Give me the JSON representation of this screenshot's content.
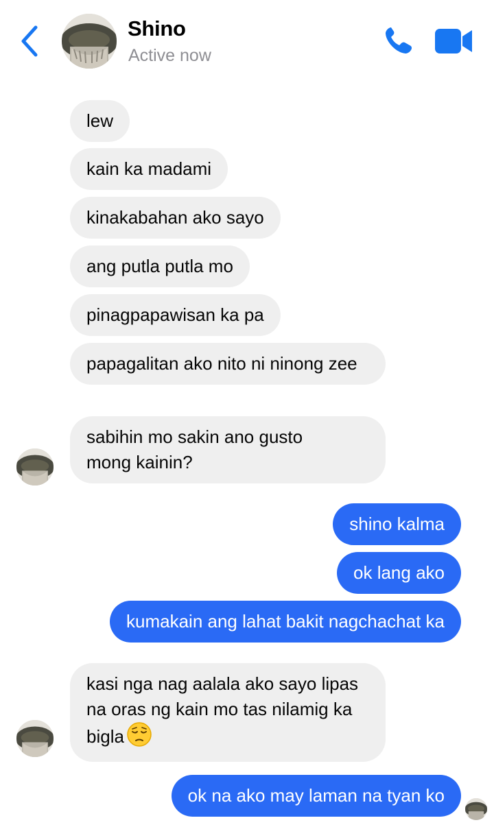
{
  "header": {
    "contact_name": "Shino",
    "status": "Active now",
    "back_icon": "chevron-left-icon",
    "call_icon": "phone-icon",
    "video_icon": "video-camera-icon",
    "accent_color": "#1877f2"
  },
  "messages": [
    {
      "side": "incoming",
      "text": "lew"
    },
    {
      "side": "incoming",
      "text": "kain ka madami"
    },
    {
      "side": "incoming",
      "text": "kinakabahan ako sayo"
    },
    {
      "side": "incoming",
      "text": "ang putla putla mo"
    },
    {
      "side": "incoming",
      "text": "pinagpapawisan ka pa"
    },
    {
      "side": "incoming",
      "text": "papagalitan ako nito ni ninong zee"
    },
    {
      "side": "incoming",
      "text": "sabihin mo sakin ano gusto mong kainin?"
    },
    {
      "side": "outgoing",
      "text": "shino kalma"
    },
    {
      "side": "outgoing",
      "text": "ok lang ako"
    },
    {
      "side": "outgoing",
      "text": "kumakain ang lahat bakit nagchachat ka"
    },
    {
      "side": "incoming",
      "text": "kasi nga nag aalala ako sayo lipas na oras ng kain mo tas nilamig ka bigla",
      "emoji": "pensive-face-emoji"
    },
    {
      "side": "outgoing",
      "text": "ok na ako may laman na tyan ko"
    }
  ],
  "colors": {
    "incoming_bubble": "#efefef",
    "outgoing_bubble": "#2a6af5",
    "status_text": "#8e8e93"
  }
}
